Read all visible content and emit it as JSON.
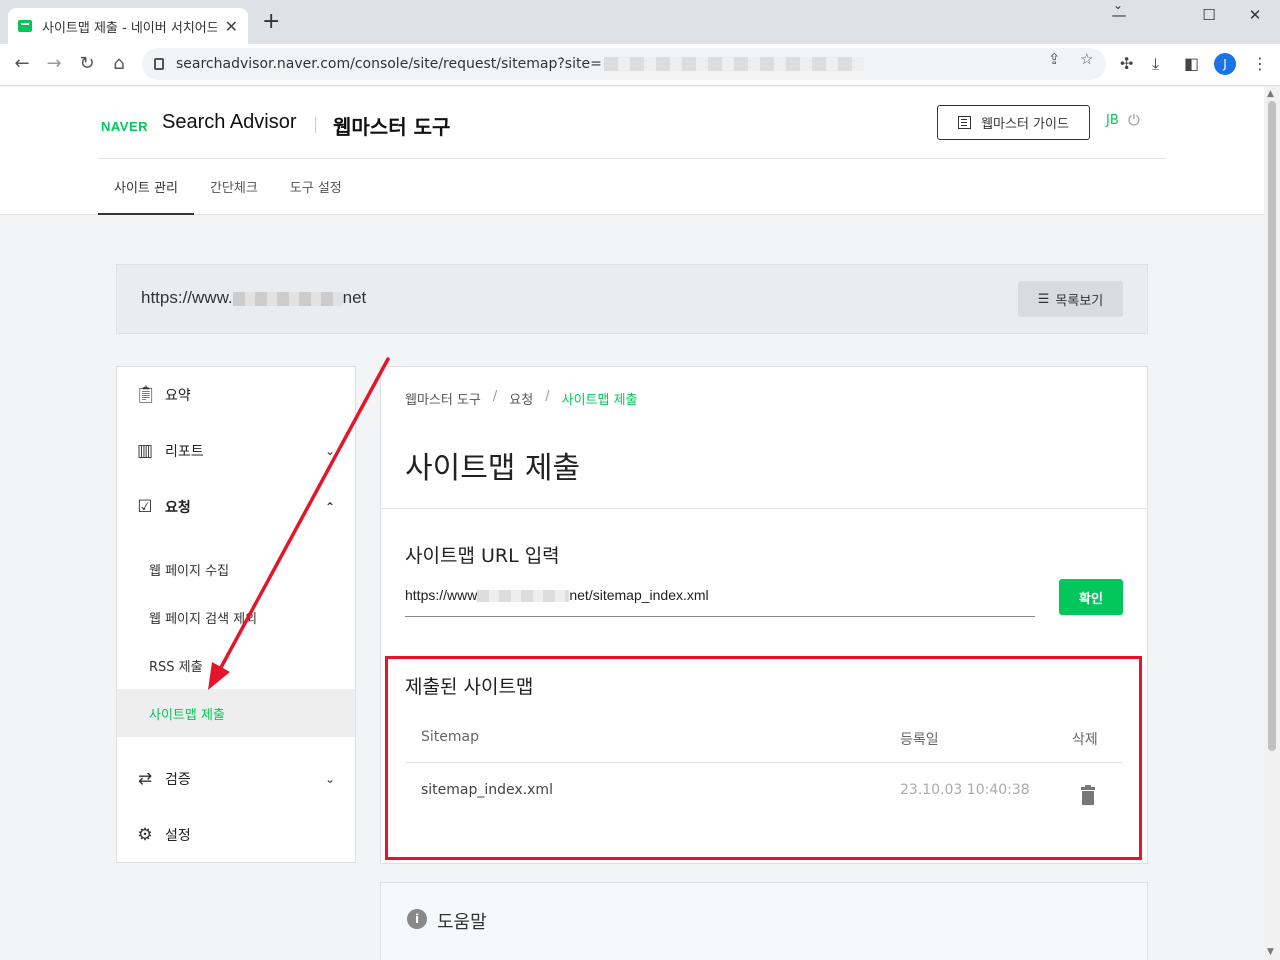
{
  "browser": {
    "tab_title": "사이트맵 제출 - 네이버 서치어드",
    "url_prefix": "searchadvisor.naver.com/console/site/request/sitemap?site=",
    "profile_initial": "J"
  },
  "header": {
    "brand": "NAVER",
    "product": "Search Advisor",
    "section": "웹마스터 도구",
    "guide_button": "웹마스터 가이드",
    "user": "JB"
  },
  "nav_tabs": [
    "사이트 관리",
    "간단체크",
    "도구 설정"
  ],
  "site_bar": {
    "url_prefix": "https://www.",
    "url_suffix": "net",
    "list_button": "목록보기"
  },
  "sidebar": {
    "items": {
      "summary": "요약",
      "report": "리포트",
      "request": "요청",
      "verify": "검증",
      "settings": "설정"
    },
    "sub_items": [
      "웹 페이지 수집",
      "웹 페이지 검색 제외",
      "RSS 제출",
      "사이트맵 제출"
    ]
  },
  "main": {
    "breadcrumb": [
      "웹마스터 도구",
      "요청",
      "사이트맵 제출"
    ],
    "title": "사이트맵 제출",
    "url_section_title": "사이트맵 URL 입력",
    "url_value_prefix": "https://www",
    "url_value_suffix": "net/sitemap_index.xml",
    "confirm_button": "확인",
    "submitted_title": "제출된 사이트맵",
    "table": {
      "headers": [
        "Sitemap",
        "등록일",
        "삭제"
      ],
      "rows": [
        {
          "sitemap": "sitemap_index.xml",
          "date": "23.10.03 10:40:38"
        }
      ]
    }
  },
  "help": {
    "title": "도움말"
  },
  "colors": {
    "brand_green": "#03c75a",
    "highlight_red": "#e3152b"
  }
}
